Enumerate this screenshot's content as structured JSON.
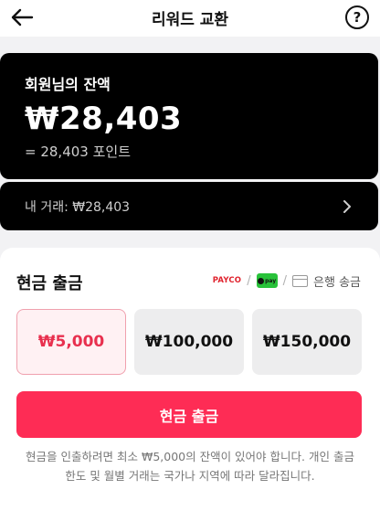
{
  "header": {
    "title": "리워드 교환",
    "help_label": "?"
  },
  "balance": {
    "label": "회원님의 잔액",
    "amount": "₩28,403",
    "points": "= 28,403 포인트"
  },
  "transactions": {
    "label": "내 거래: ₩28,403"
  },
  "withdraw": {
    "title": "현금 출금",
    "methods": {
      "payco": "PAYCO",
      "pay_logo_text": "pay",
      "separator": "/",
      "bank_label": "은행 송금"
    },
    "options": [
      "₩5,000",
      "₩100,000",
      "₩150,000"
    ],
    "selected_option": "₩5,000",
    "button_label": "현금 출금",
    "notice": "현금을 인출하려면 최소 ₩5,000의 잔액이 있어야 합니다. 개인 출금 한도 및 월별 거래는 국가나 지역에 따라 달라집니다."
  },
  "colors": {
    "accent": "#fe2c55",
    "selected_text": "#e8304e",
    "card_background": "#000000"
  }
}
